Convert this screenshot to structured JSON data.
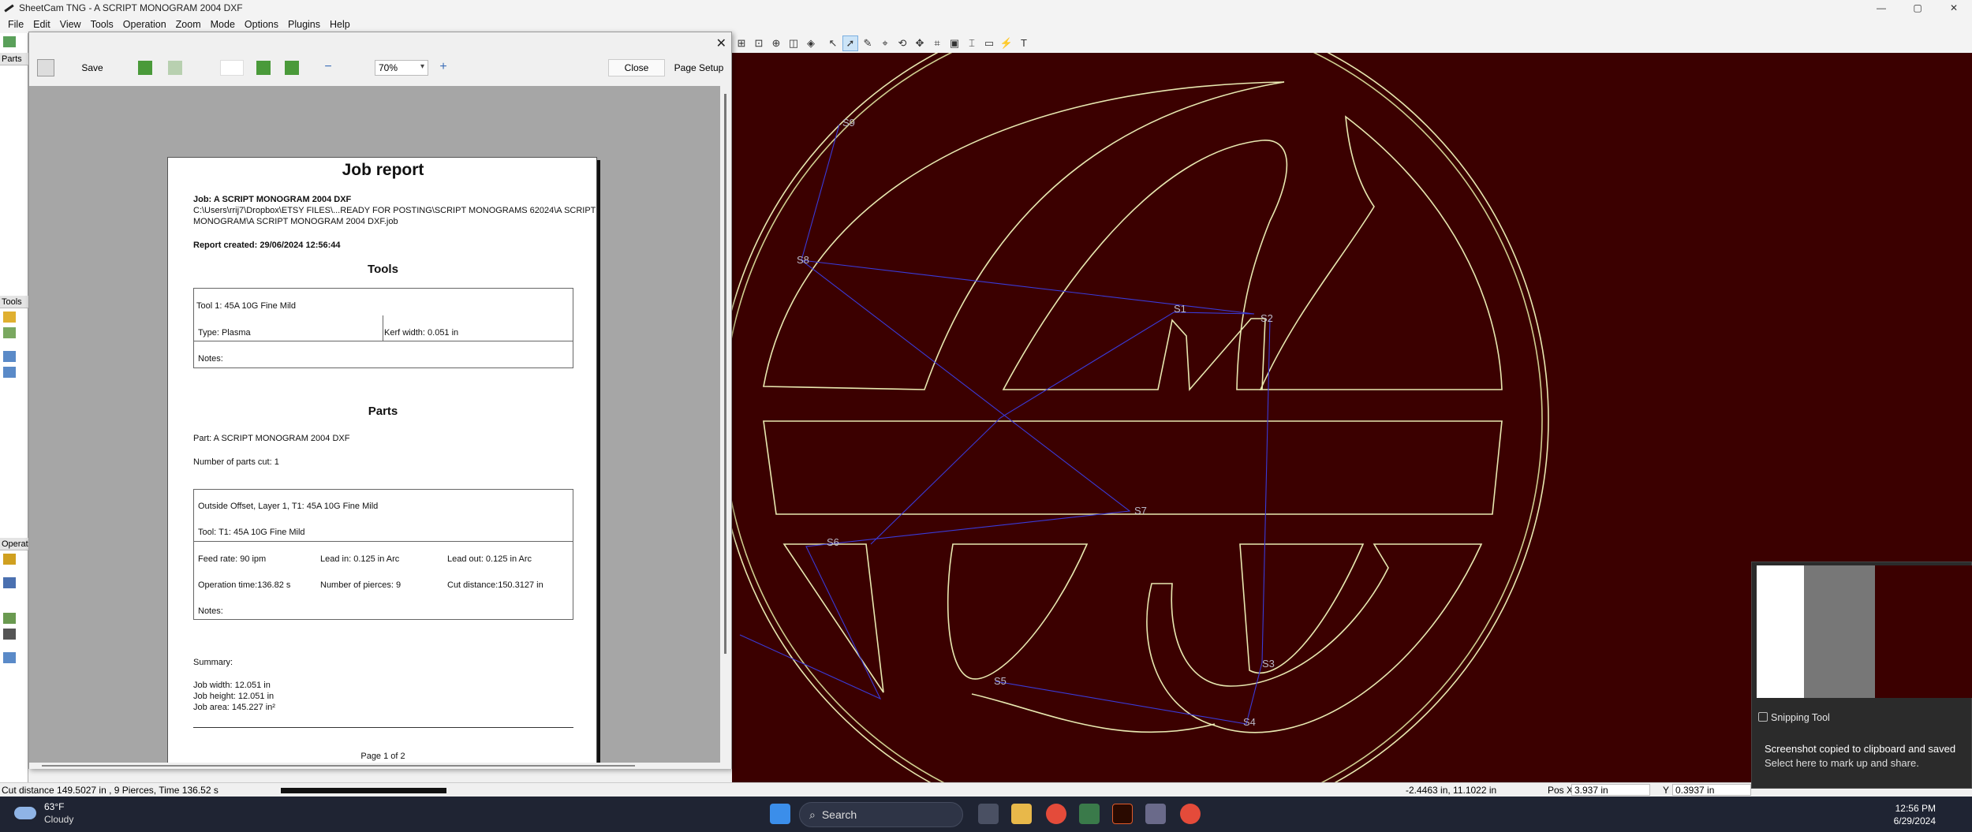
{
  "window": {
    "title": "SheetCam TNG - A SCRIPT MONOGRAM 2004 DXF",
    "controls": [
      "—",
      "▢",
      "✕"
    ]
  },
  "menu": [
    "File",
    "Edit",
    "View",
    "Tools",
    "Operation",
    "Zoom",
    "Mode",
    "Options",
    "Plugins",
    "Help"
  ],
  "left_panel": {
    "parts_label": "Parts",
    "tools_label": "Tools",
    "operations_label": "Operat"
  },
  "dialog": {
    "save_label": "Save",
    "zoom_value": "70%",
    "close_label": "Close",
    "page_setup_label": "Page Setup",
    "close_x": "✕"
  },
  "report": {
    "title": "Job report",
    "job_line": "Job: A SCRIPT MONOGRAM 2004 DXF",
    "path_line1": "C:\\Users\\rrij7\\Dropbox\\ETSY FILES\\...READY FOR POSTING\\SCRIPT MONOGRAMS 62024\\A SCRIPT",
    "path_line2": "MONOGRAM\\A SCRIPT MONOGRAM 2004 DXF.job",
    "created": "Report created: 29/06/2024 12:56:44",
    "tools_heading": "Tools",
    "tool_name": "Tool 1: 45A 10G Fine Mild",
    "tool_type": "Type: Plasma",
    "tool_kerf": "Kerf width: 0.051 in",
    "tool_notes": "Notes:",
    "parts_heading": "Parts",
    "part_line": "Part: A SCRIPT MONOGRAM 2004 DXF",
    "parts_cut": "Number of parts cut: 1",
    "op_name": "Outside Offset, Layer 1, T1: 45A 10G Fine Mild",
    "op_tool": "Tool: T1: 45A 10G Fine Mild",
    "feed_rate": "Feed rate: 90 ipm",
    "lead_in": "Lead in: 0.125 in Arc",
    "lead_out": "Lead out: 0.125 in Arc",
    "op_time": "Operation time:136.82 s",
    "pierces": "Number of pierces: 9",
    "cut_distance": "Cut distance:150.3127 in",
    "op_notes": "Notes:",
    "summary": "Summary:",
    "job_width": "Job width: 12.051 in",
    "job_height": "Job height: 12.051 in",
    "job_area": "Job area: 145.227 in²",
    "page_number": "Page 1 of 2"
  },
  "canvas": {
    "background": "#3b0000",
    "outline_color": "#e8e8b0",
    "path_color": "#3a3ad8",
    "labels": [
      "S9",
      "S8",
      "S1",
      "S2",
      "S7",
      "S6",
      "S5",
      "S3",
      "S4"
    ]
  },
  "status": {
    "cut_info": "Cut distance 149.5027 in , 9 Pierces, Time 136.52 s",
    "cursor": "-2.4463 in, 11.1022 in",
    "pos_x_label": "Pos X",
    "pos_x_value": "3.937 in",
    "pos_y_label": "Y",
    "pos_y_value": "0.3937 in"
  },
  "taskbar": {
    "temperature": "63°F",
    "weather": "Cloudy",
    "search_placeholder": "Search",
    "time": "12:56 PM",
    "date": "6/29/2024"
  },
  "notification": {
    "app": "Snipping Tool",
    "line1": "Screenshot copied to clipboard and saved",
    "line2": "Select here to mark up and share."
  }
}
